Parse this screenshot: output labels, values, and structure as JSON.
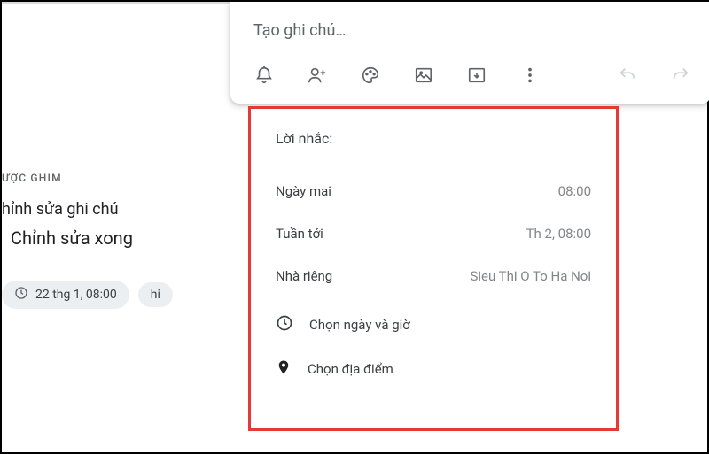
{
  "left": {
    "section_header": "ƯỢC GHIM",
    "note_title": "hỉnh sửa ghi chú",
    "note_body": "Chỉnh sửa xong",
    "chip1_label": "22 thg 1, 08:00",
    "chip2_label": "hi"
  },
  "card": {
    "placeholder": "Tạo ghi chú…"
  },
  "toolbar": {
    "bell": "bell-icon",
    "person_add": "person-add-icon",
    "palette": "palette-icon",
    "image": "image-icon",
    "archive": "archive-icon",
    "more": "more-icon",
    "undo": "undo-icon",
    "redo": "redo-icon"
  },
  "reminder": {
    "title": "Lời nhắc:",
    "row1_label": "Ngày mai",
    "row1_value": "08:00",
    "row2_label": "Tuần tới",
    "row2_value": "Th 2, 08:00",
    "row3_label": "Nhà riêng",
    "row3_value": "Sieu Thi O To Ha Noi",
    "action1": "Chọn ngày và giờ",
    "action2": "Chọn địa điểm"
  }
}
